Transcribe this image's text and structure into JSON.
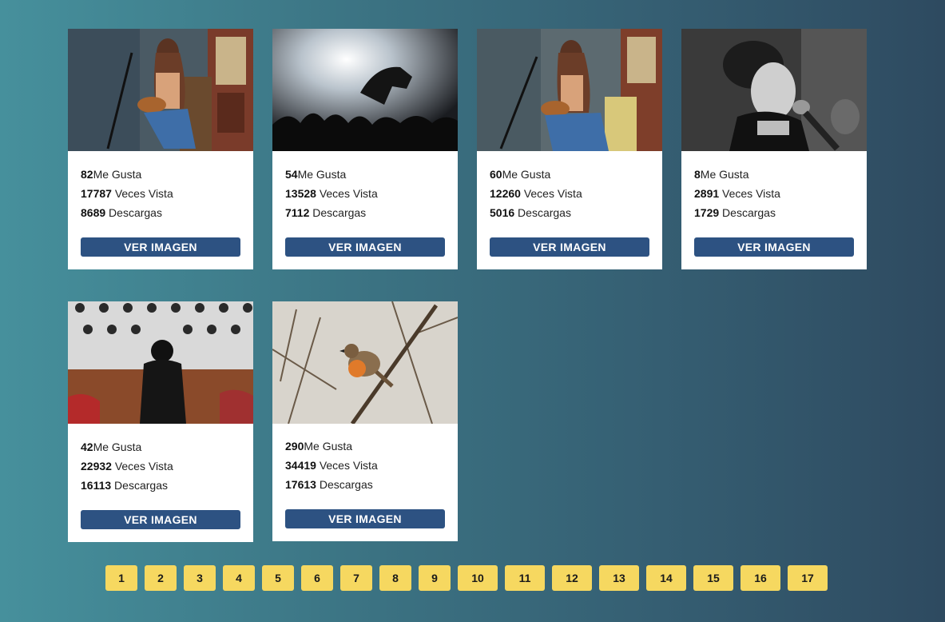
{
  "cards": [
    {
      "likes": "82",
      "likes_label": "Me Gusta",
      "views": "17787",
      "views_label": " Veces Vista",
      "downloads": "8689",
      "downloads_label": " Descargas",
      "button": "VER IMAGEN",
      "image": "singer-guitar-image"
    },
    {
      "likes": "54",
      "likes_label": "Me Gusta",
      "views": "13528",
      "views_label": " Veces Vista",
      "downloads": "7112",
      "downloads_label": " Descargas",
      "button": "VER IMAGEN",
      "image": "concert-crowd-image"
    },
    {
      "likes": "60",
      "likes_label": "Me Gusta",
      "views": "12260",
      "views_label": " Veces Vista",
      "downloads": "5016",
      "downloads_label": " Descargas",
      "button": "VER IMAGEN",
      "image": "singer-guitar-image"
    },
    {
      "likes": "8",
      "likes_label": "Me Gusta",
      "views": "2891",
      "views_label": " Veces Vista",
      "downloads": "1729",
      "downloads_label": " Descargas",
      "button": "VER IMAGEN",
      "image": "singer-microphone-image"
    },
    {
      "likes": "42",
      "likes_label": "Me Gusta",
      "views": "22932",
      "views_label": " Veces Vista",
      "downloads": "16113",
      "downloads_label": " Descargas",
      "button": "VER IMAGEN",
      "image": "choir-conductor-image"
    },
    {
      "likes": "290",
      "likes_label": "Me Gusta",
      "views": "34419",
      "views_label": " Veces Vista",
      "downloads": "17613",
      "downloads_label": " Descargas",
      "button": "VER IMAGEN",
      "image": "robin-bird-image"
    }
  ],
  "pagination": [
    "1",
    "2",
    "3",
    "4",
    "5",
    "6",
    "7",
    "8",
    "9",
    "10",
    "11",
    "12",
    "13",
    "14",
    "15",
    "16",
    "17"
  ],
  "colors": {
    "button": "#2d5282",
    "page_button": "#f6d860",
    "background_start": "#46909c",
    "background_end": "#2e4a60"
  }
}
